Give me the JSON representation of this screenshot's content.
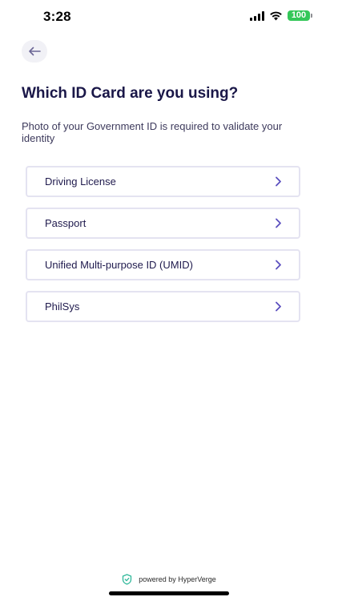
{
  "status_bar": {
    "time": "3:28",
    "battery": "100",
    "battery_color": "#34c759",
    "icons": [
      "signal-icon",
      "wifi-icon",
      "battery-icon"
    ]
  },
  "header": {
    "back_icon": "arrow-left-icon"
  },
  "page": {
    "title": "Which ID Card are you using?",
    "subtitle": "Photo of your Government ID is required to validate your identity"
  },
  "options": [
    {
      "label": "Driving License"
    },
    {
      "label": "Passport"
    },
    {
      "label": "Unified Multi-purpose ID (UMID)"
    },
    {
      "label": "PhilSys"
    }
  ],
  "footer": {
    "text": "powered by HyperVerge",
    "icon": "shield-check-icon"
  },
  "colors": {
    "accent": "#5b4fbf",
    "title": "#1a1748",
    "border": "#e4e3f1",
    "footer_icon": "#2fb89a"
  }
}
